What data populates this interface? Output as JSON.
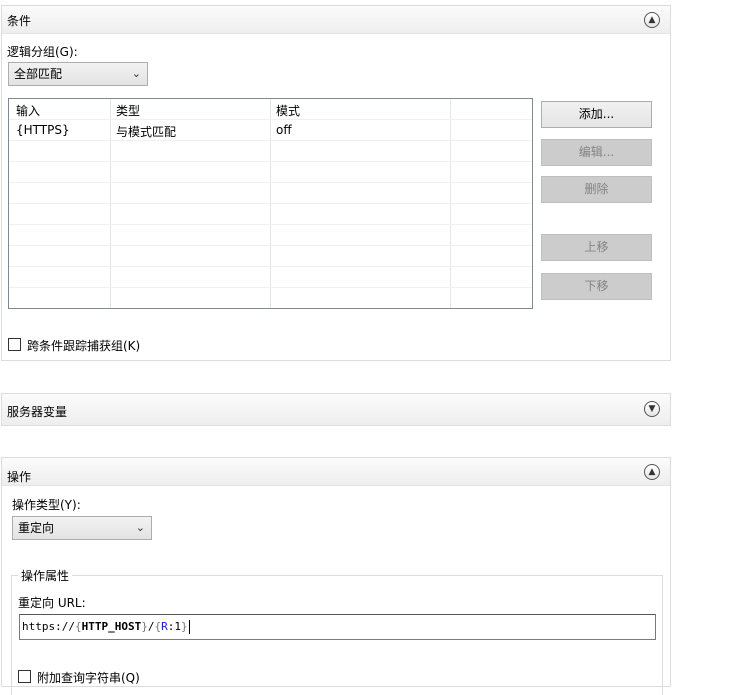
{
  "conditions": {
    "title": "条件",
    "logic_group_label": "逻辑分组(G):",
    "logic_group_value": "全部匹配",
    "columns": [
      "输入",
      "类型",
      "模式"
    ],
    "rows": [
      {
        "input": "{HTTPS}",
        "type": "与模式匹配",
        "pattern": "off"
      }
    ],
    "buttons": {
      "add": "添加...",
      "edit": "编辑...",
      "delete": "删除",
      "move_up": "上移",
      "move_down": "下移"
    },
    "track_capture_label": "跨条件跟踪捕获组(K)"
  },
  "server_vars": {
    "title": "服务器变量"
  },
  "action": {
    "title": "操作",
    "type_label": "操作类型(Y):",
    "type_value": "重定向",
    "props_legend": "操作属性",
    "url_label": "重定向 URL:",
    "url_tokens": [
      {
        "text": "https://",
        "cls": "tok-text"
      },
      {
        "text": "{",
        "cls": "tok-brace"
      },
      {
        "text": "HTTP_HOST",
        "cls": "tok-var"
      },
      {
        "text": "}",
        "cls": "tok-brace"
      },
      {
        "text": "/",
        "cls": "tok-text"
      },
      {
        "text": "{",
        "cls": "tok-brace"
      },
      {
        "text": "R",
        "cls": "tok-kw"
      },
      {
        "text": ":1",
        "cls": "tok-text"
      },
      {
        "text": "}",
        "cls": "tok-brace"
      }
    ],
    "append_query_label": "附加查询字符串(Q)"
  },
  "icons": {
    "collapse": "chevron-up-icon",
    "expand": "chevron-down-icon"
  }
}
